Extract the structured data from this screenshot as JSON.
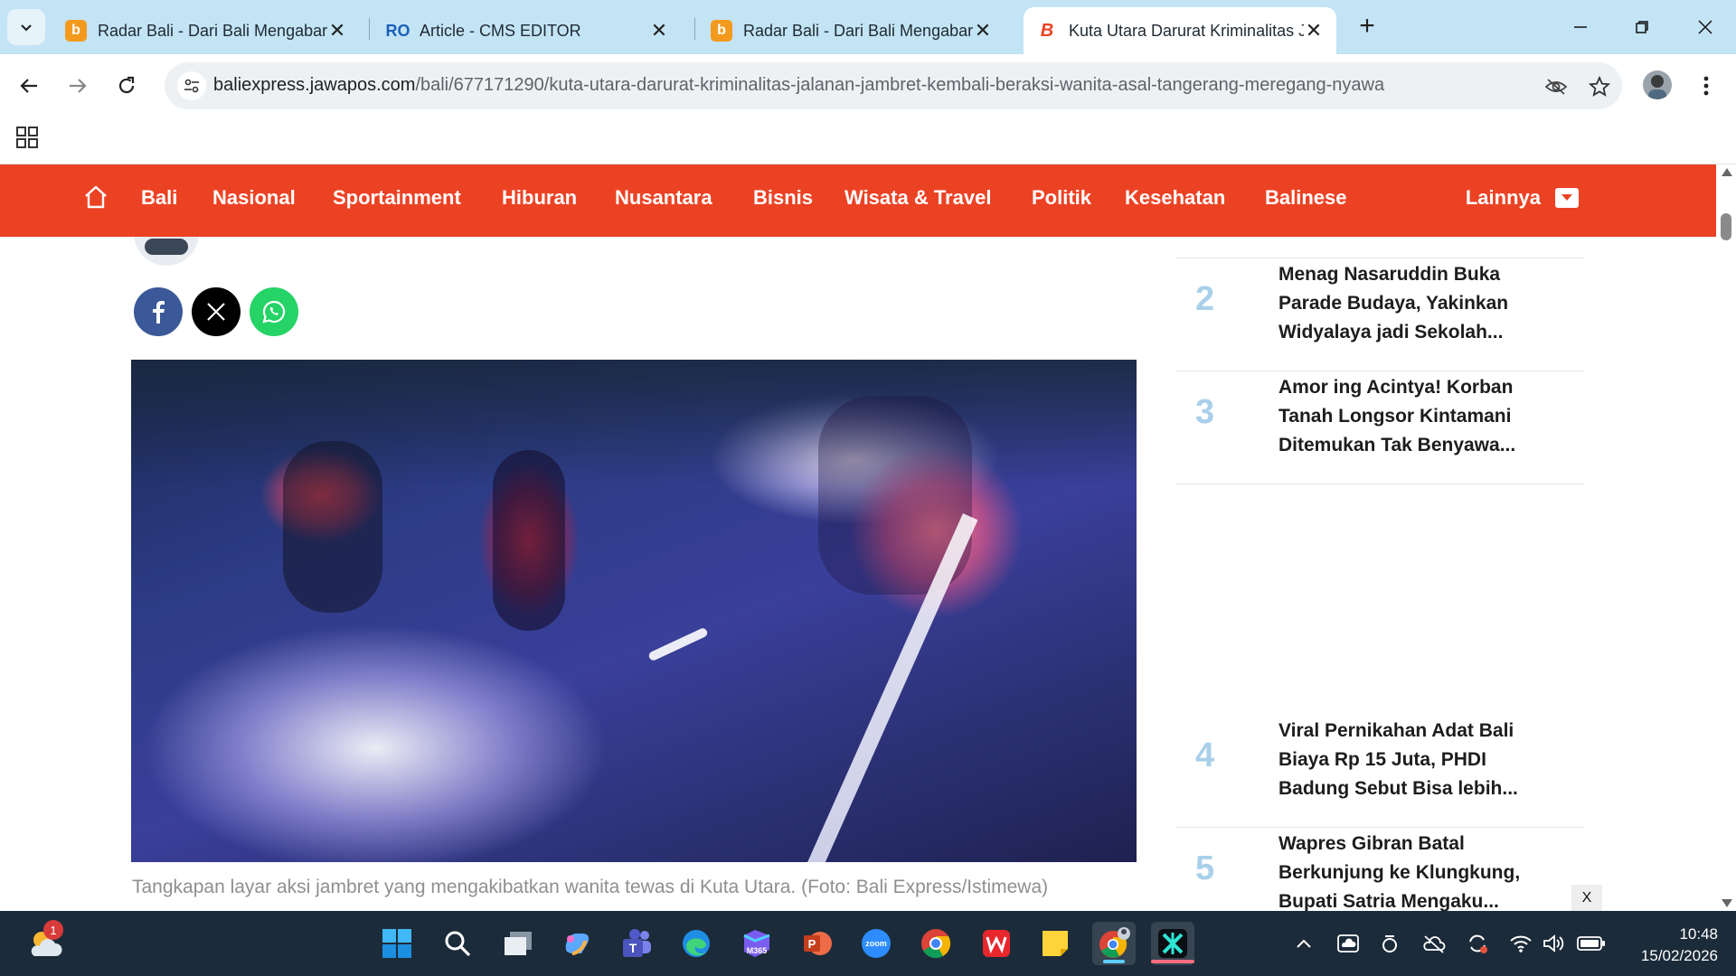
{
  "browser": {
    "tabs": [
      {
        "title": "Radar Bali - Dari Bali Mengabarkan",
        "favicon": "radar-bali-favicon",
        "active": false
      },
      {
        "title": "Article - CMS EDITOR",
        "favicon": "cms-editor-favicon",
        "active": false
      },
      {
        "title": "Radar Bali - Dari Bali Mengabarkan",
        "favicon": "radar-bali-favicon",
        "active": false
      },
      {
        "title": "Kuta Utara Darurat Kriminalitas Jalanan",
        "favicon": "bali-express-favicon",
        "active": true
      }
    ],
    "url_host": "baliexpress.jawapos.com",
    "url_path": "/bali/677171290/kuta-utara-darurat-kriminalitas-jalanan-jambret-kembali-beraksi-wanita-asal-tangerang-meregang-nyawa"
  },
  "site": {
    "brand_color": "#ec4224",
    "nav": {
      "items": [
        "Bali",
        "Nasional",
        "Sportainment",
        "Hiburan",
        "Nusantara",
        "Bisnis",
        "Wisata & Travel",
        "Politik",
        "Kesehatan",
        "Balinese"
      ],
      "more_label": "Lainnya"
    }
  },
  "article": {
    "caption": "Tangkapan layar aksi jambret yang mengakibatkan wanita tewas di Kuta Utara. (Foto: Bali Express/Istimewa)",
    "share": [
      "facebook-icon",
      "x-icon",
      "whatsapp-icon"
    ]
  },
  "sidebar": {
    "popular": [
      {
        "rank": "2",
        "title": "Menag Nasaruddin Buka Parade Budaya, Yakinkan Widyalaya jadi Sekolah..."
      },
      {
        "rank": "3",
        "title": "Amor ing Acintya! Korban Tanah Longsor Kintamani Ditemukan Tak Benyawa..."
      },
      {
        "rank": "4",
        "title": "Viral Pernikahan Adat Bali Biaya Rp 15 Juta, PHDI Badung Sebut Bisa lebih..."
      },
      {
        "rank": "5",
        "title": "Wapres Gibran Batal Berkunjung ke Klungkung, Bupati Satria Mengaku..."
      }
    ],
    "close_label": "X"
  },
  "taskbar": {
    "weather_badge": "1",
    "time": "10:48",
    "date": "15/02/2026",
    "apps": [
      "windows-start-icon",
      "search-icon",
      "task-view-icon",
      "copilot-icon",
      "teams-icon",
      "edge-icon",
      "m365-icon",
      "powerpoint-icon",
      "zoom-icon",
      "chrome-icon",
      "wps-icon",
      "sticky-notes-icon",
      "chrome-profile-icon",
      "capcut-icon"
    ]
  }
}
